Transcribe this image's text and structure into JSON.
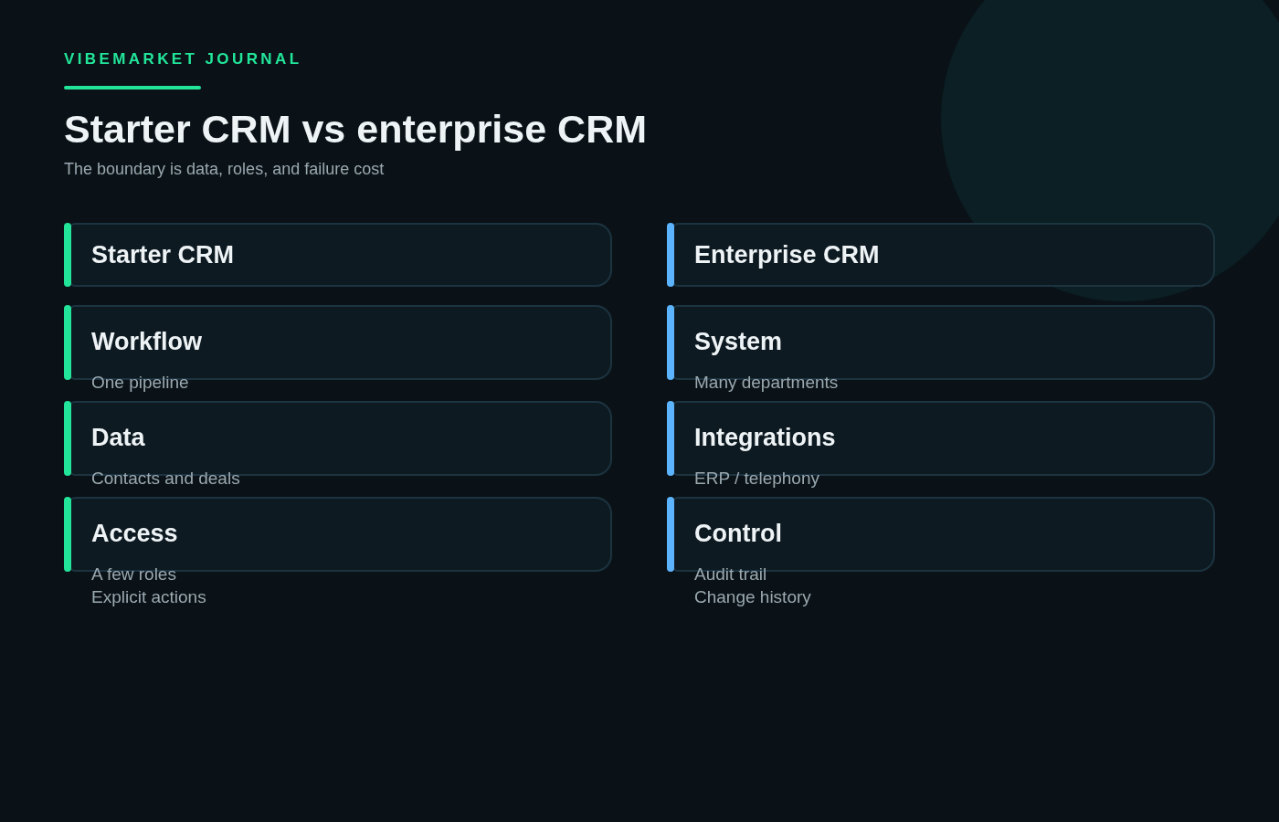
{
  "brand": "VIBEMARKET JOURNAL",
  "title": "Starter CRM vs enterprise CRM",
  "subtitle": "The boundary is data, roles, and failure cost",
  "columns": [
    {
      "heading": "Starter CRM",
      "color": "#22e59a",
      "items": [
        {
          "title": "Workflow",
          "lines": [
            "One pipeline"
          ]
        },
        {
          "title": "Data",
          "lines": [
            "Contacts and deals"
          ]
        },
        {
          "title": "Access",
          "lines": [
            "A few roles",
            "Explicit actions"
          ]
        }
      ]
    },
    {
      "heading": "Enterprise CRM",
      "color": "#5cb4ff",
      "items": [
        {
          "title": "System",
          "lines": [
            "Many departments"
          ]
        },
        {
          "title": "Integrations",
          "lines": [
            "ERP / telephony"
          ]
        },
        {
          "title": "Control",
          "lines": [
            "Audit trail",
            "Change history"
          ]
        }
      ]
    }
  ]
}
